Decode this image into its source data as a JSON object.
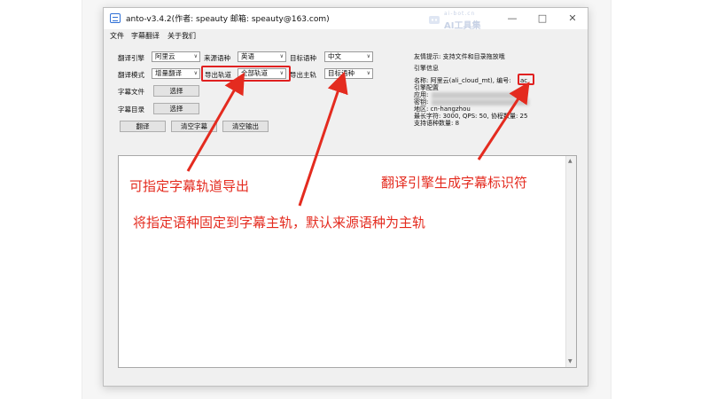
{
  "window": {
    "title": "anto-v3.4.2(作者: speauty 邮箱: speauty@163.com)",
    "watermark": {
      "url": "ai-bot.cn",
      "name": "AI工具集"
    }
  },
  "menu": [
    "文件",
    "字幕翻译",
    "关于我们"
  ],
  "form": {
    "engine_label": "翻译引擎",
    "engine_value": "阿里云",
    "source_lang_label": "来源语种",
    "source_lang_value": "英语",
    "target_lang_label": "目标语种",
    "target_lang_value": "中文",
    "mode_label": "翻译模式",
    "mode_value": "增量翻译",
    "export_track_label": "导出轨道",
    "export_track_value": "全部轨道",
    "export_main_label": "导出主轨",
    "export_main_value": "目标语种",
    "subtitle_file_label": "字幕文件",
    "subtitle_file_button": "选择",
    "subtitle_dir_label": "字幕目录",
    "subtitle_dir_button": "选择",
    "translate_button": "翻译",
    "clear_subtitle_button": "清空字幕",
    "clear_output_button": "清空输出"
  },
  "info": {
    "hint": "友情提示: 支持文件和目录拖放哦",
    "engine_info_title": "引擎信息",
    "name_line": "名称: 阿里云(ali_cloud_mt), 编号:",
    "engine_code": "ac",
    "config_title": "引擎配置",
    "app_label": "应用:",
    "secret_label": "密钥:",
    "region_line": "地区: cn-hangzhou",
    "limits_line": "最长字符: 3000, QPS: 50, 协程数量: 25",
    "lang_count_line": "支持语种数量: 8"
  },
  "annotations": {
    "track_export": "可指定字幕轨道导出",
    "main_track": "将指定语种固定到字幕主轨，默认来源语种为主轨",
    "engine_id": "翻译引擎生成字幕标识符"
  },
  "colors": {
    "annotation": "#e42b1f",
    "window_bg": "#f0f0f0"
  }
}
